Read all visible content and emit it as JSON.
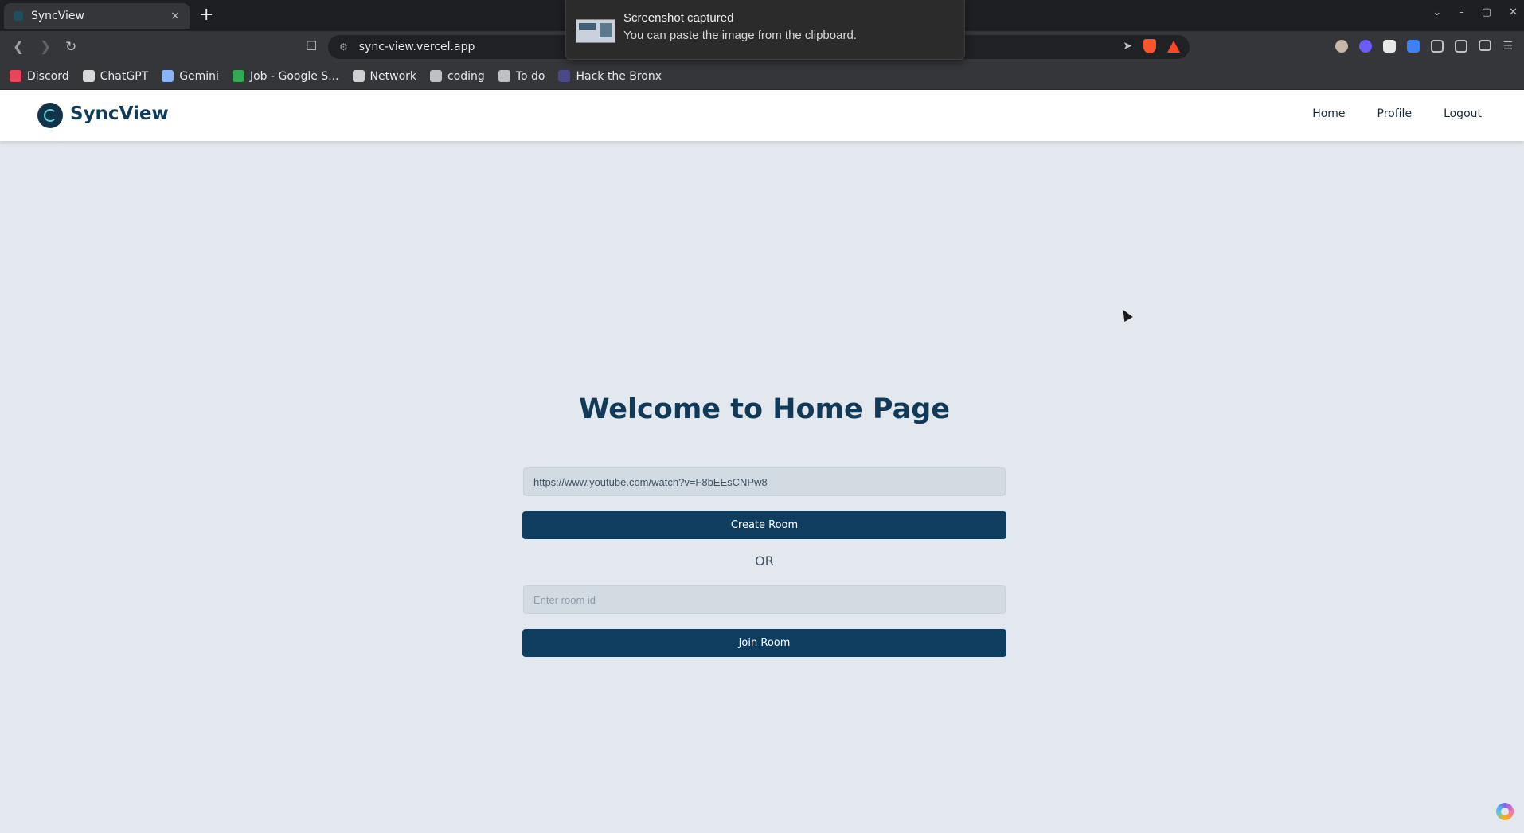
{
  "browser": {
    "tab_title": "SyncView",
    "tab_close": "×",
    "new_tab": "+",
    "url": "sync-view.vercel.app",
    "window_controls": [
      "⌄",
      "–",
      "▢",
      "✕"
    ],
    "bookmarks": [
      {
        "label": "Discord",
        "icon": "discord-icon",
        "color": "#e8455d"
      },
      {
        "label": "ChatGPT",
        "icon": "chatgpt-icon",
        "color": "#d9d9d9"
      },
      {
        "label": "Gemini",
        "icon": "gemini-icon",
        "color": "#8ab4f8"
      },
      {
        "label": "Job - Google S...",
        "icon": "google-sheets-icon",
        "color": "#34a853"
      },
      {
        "label": "Network",
        "icon": "network-icon",
        "color": "#cfcfcf"
      },
      {
        "label": "coding",
        "icon": "folder-icon",
        "color": "#bdc1c6"
      },
      {
        "label": "To do",
        "icon": "folder-icon",
        "color": "#bdc1c6"
      },
      {
        "label": "Hack the Bronx",
        "icon": "hack-the-bronx-icon",
        "color": "#4a4a8a"
      }
    ]
  },
  "notification": {
    "title": "Screenshot captured",
    "body": "You can paste the image from the clipboard."
  },
  "navbar": {
    "brand": "SyncView",
    "links": [
      "Home",
      "Profile",
      "Logout"
    ]
  },
  "main": {
    "title": "Welcome to Home Page",
    "video_url_value": "https://www.youtube.com/watch?v=F8bEEsCNPw8",
    "create_button": "Create Room",
    "or_text": "OR",
    "room_id_placeholder": "Enter room id",
    "join_button": "Join Room"
  },
  "colors": {
    "primary": "#0e3d5f",
    "background": "#e2e8ee",
    "title": "#113a59"
  }
}
